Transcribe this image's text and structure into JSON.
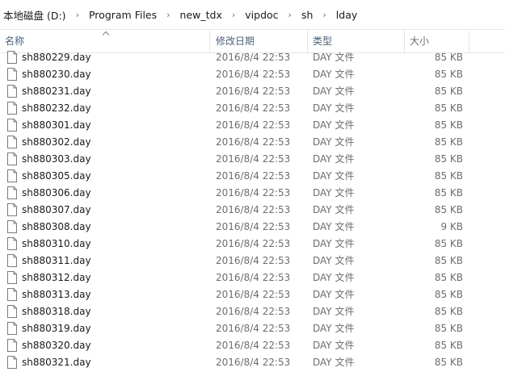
{
  "breadcrumb": [
    "本地磁盘 (D:)",
    "Program Files",
    "new_tdx",
    "vipdoc",
    "sh",
    "lday"
  ],
  "columns": {
    "name": "名称",
    "date": "修改日期",
    "type": "类型",
    "size": "大小"
  },
  "files": [
    {
      "name": "sh880229.day",
      "date": "2016/8/4 22:53",
      "type": "DAY 文件",
      "size": "85 KB"
    },
    {
      "name": "sh880230.day",
      "date": "2016/8/4 22:53",
      "type": "DAY 文件",
      "size": "85 KB"
    },
    {
      "name": "sh880231.day",
      "date": "2016/8/4 22:53",
      "type": "DAY 文件",
      "size": "85 KB"
    },
    {
      "name": "sh880232.day",
      "date": "2016/8/4 22:53",
      "type": "DAY 文件",
      "size": "85 KB"
    },
    {
      "name": "sh880301.day",
      "date": "2016/8/4 22:53",
      "type": "DAY 文件",
      "size": "85 KB"
    },
    {
      "name": "sh880302.day",
      "date": "2016/8/4 22:53",
      "type": "DAY 文件",
      "size": "85 KB"
    },
    {
      "name": "sh880303.day",
      "date": "2016/8/4 22:53",
      "type": "DAY 文件",
      "size": "85 KB"
    },
    {
      "name": "sh880305.day",
      "date": "2016/8/4 22:53",
      "type": "DAY 文件",
      "size": "85 KB"
    },
    {
      "name": "sh880306.day",
      "date": "2016/8/4 22:53",
      "type": "DAY 文件",
      "size": "85 KB"
    },
    {
      "name": "sh880307.day",
      "date": "2016/8/4 22:53",
      "type": "DAY 文件",
      "size": "85 KB"
    },
    {
      "name": "sh880308.day",
      "date": "2016/8/4 22:53",
      "type": "DAY 文件",
      "size": "9 KB"
    },
    {
      "name": "sh880310.day",
      "date": "2016/8/4 22:53",
      "type": "DAY 文件",
      "size": "85 KB"
    },
    {
      "name": "sh880311.day",
      "date": "2016/8/4 22:53",
      "type": "DAY 文件",
      "size": "85 KB"
    },
    {
      "name": "sh880312.day",
      "date": "2016/8/4 22:53",
      "type": "DAY 文件",
      "size": "85 KB"
    },
    {
      "name": "sh880313.day",
      "date": "2016/8/4 22:53",
      "type": "DAY 文件",
      "size": "85 KB"
    },
    {
      "name": "sh880318.day",
      "date": "2016/8/4 22:53",
      "type": "DAY 文件",
      "size": "85 KB"
    },
    {
      "name": "sh880319.day",
      "date": "2016/8/4 22:53",
      "type": "DAY 文件",
      "size": "85 KB"
    },
    {
      "name": "sh880320.day",
      "date": "2016/8/4 22:53",
      "type": "DAY 文件",
      "size": "85 KB"
    },
    {
      "name": "sh880321.day",
      "date": "2016/8/4 22:53",
      "type": "DAY 文件",
      "size": "85 KB"
    }
  ],
  "icons": {
    "file": "blank-document-icon",
    "separator": "chevron-right-icon",
    "sort": "sort-ascending-icon"
  },
  "colors": {
    "header_text": "#4c607a",
    "secondary_text": "#6d6d6d"
  }
}
